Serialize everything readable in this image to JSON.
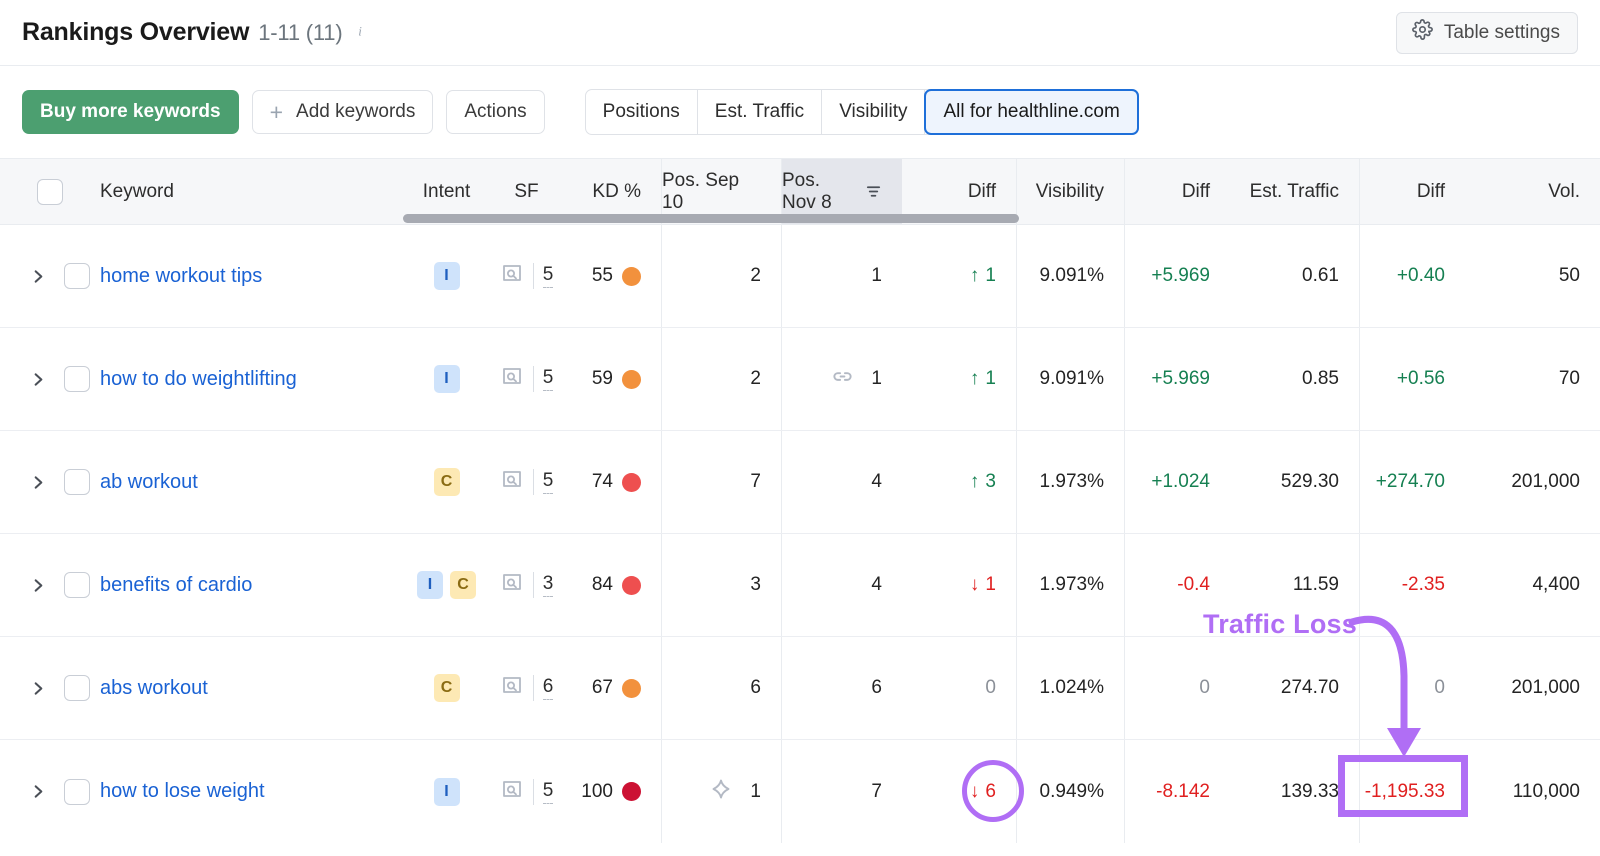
{
  "header": {
    "title": "Rankings Overview",
    "count_range": "1-11 (11)",
    "info_icon": "info-icon",
    "table_settings_label": "Table settings",
    "gear_icon": "gear-icon"
  },
  "toolbar": {
    "buy_label": "Buy more keywords",
    "add_label": "Add keywords",
    "add_plus": "+",
    "actions_label": "Actions",
    "segments": [
      {
        "label": "Positions",
        "active": false
      },
      {
        "label": "Est. Traffic",
        "active": false
      },
      {
        "label": "Visibility",
        "active": false
      },
      {
        "label": "All for healthline.com",
        "active": true
      }
    ]
  },
  "table": {
    "columns": [
      {
        "key": "check",
        "label": ""
      },
      {
        "key": "kw",
        "label": "Keyword"
      },
      {
        "key": "intent",
        "label": "Intent"
      },
      {
        "key": "sf",
        "label": "SF"
      },
      {
        "key": "kd",
        "label": "KD %"
      },
      {
        "key": "pos1",
        "label": "Pos. Sep 10"
      },
      {
        "key": "pos2",
        "label": "Pos. Nov 8",
        "sorted": true,
        "sort_icon": "sort-descending-icon"
      },
      {
        "key": "diff1",
        "label": "Diff"
      },
      {
        "key": "vis",
        "label": "Visibility"
      },
      {
        "key": "diffv",
        "label": "Diff"
      },
      {
        "key": "traf",
        "label": "Est. Traffic"
      },
      {
        "key": "difft",
        "label": "Diff"
      },
      {
        "key": "vol",
        "label": "Vol."
      }
    ],
    "scrollbar": {
      "name": "horizontal-scrollbar"
    },
    "rows": [
      {
        "keyword": "home workout tips",
        "intent": [
          "I"
        ],
        "sf_icon": "serp-feature-icon",
        "sf": "5",
        "kd": "55",
        "kd_color": "#f2913d",
        "pos_sep": "2",
        "pos_sep_icon": "",
        "pos_nov": "1",
        "pos_nov_icon": "",
        "diff_pos": "1",
        "diff_pos_arrow": "↑",
        "diff_pos_dir": "up",
        "visibility": "9.091%",
        "diff_vis": "+5.969",
        "diff_vis_dir": "up",
        "traffic": "0.61",
        "diff_traf": "+0.40",
        "diff_traf_dir": "up",
        "vol": "50"
      },
      {
        "keyword": "how to do weightlifting",
        "intent": [
          "I"
        ],
        "sf_icon": "serp-feature-icon",
        "sf": "5",
        "kd": "59",
        "kd_color": "#f2913d",
        "pos_sep": "2",
        "pos_sep_icon": "",
        "pos_nov": "1",
        "pos_nov_icon": "link-icon",
        "diff_pos": "1",
        "diff_pos_arrow": "↑",
        "diff_pos_dir": "up",
        "visibility": "9.091%",
        "diff_vis": "+5.969",
        "diff_vis_dir": "up",
        "traffic": "0.85",
        "diff_traf": "+0.56",
        "diff_traf_dir": "up",
        "vol": "70"
      },
      {
        "keyword": "ab workout",
        "intent": [
          "C"
        ],
        "sf_icon": "serp-feature-icon",
        "sf": "5",
        "kd": "74",
        "kd_color": "#ee4f4f",
        "pos_sep": "7",
        "pos_sep_icon": "",
        "pos_nov": "4",
        "pos_nov_icon": "",
        "diff_pos": "3",
        "diff_pos_arrow": "↑",
        "diff_pos_dir": "up",
        "visibility": "1.973%",
        "diff_vis": "+1.024",
        "diff_vis_dir": "up",
        "traffic": "529.30",
        "diff_traf": "+274.70",
        "diff_traf_dir": "up",
        "vol": "201,000"
      },
      {
        "keyword": "benefits of cardio",
        "intent": [
          "I",
          "C"
        ],
        "sf_icon": "serp-feature-icon",
        "sf": "3",
        "kd": "84",
        "kd_color": "#ee4f4f",
        "pos_sep": "3",
        "pos_sep_icon": "",
        "pos_nov": "4",
        "pos_nov_icon": "",
        "diff_pos": "1",
        "diff_pos_arrow": "↓",
        "diff_pos_dir": "down",
        "visibility": "1.973%",
        "diff_vis": "-0.4",
        "diff_vis_dir": "down",
        "traffic": "11.59",
        "diff_traf": "-2.35",
        "diff_traf_dir": "down",
        "vol": "4,400"
      },
      {
        "keyword": "abs workout",
        "intent": [
          "C"
        ],
        "sf_icon": "serp-feature-icon",
        "sf": "6",
        "kd": "67",
        "kd_color": "#f2913d",
        "pos_sep": "6",
        "pos_sep_icon": "",
        "pos_nov": "6",
        "pos_nov_icon": "",
        "diff_pos": "0",
        "diff_pos_arrow": "",
        "diff_pos_dir": "zero",
        "visibility": "1.024%",
        "diff_vis": "0",
        "diff_vis_dir": "zero",
        "traffic": "274.70",
        "diff_traf": "0",
        "diff_traf_dir": "zero",
        "vol": "201,000"
      },
      {
        "keyword": "how to lose weight",
        "intent": [
          "I"
        ],
        "sf_icon": "serp-feature-icon",
        "sf": "5",
        "kd": "100",
        "kd_color": "#cc1133",
        "pos_sep": "1",
        "pos_sep_icon": "ai-overview-icon",
        "pos_nov": "7",
        "pos_nov_icon": "",
        "diff_pos": "6",
        "diff_pos_arrow": "↓",
        "diff_pos_dir": "down",
        "visibility": "0.949%",
        "diff_vis": "-8.142",
        "diff_vis_dir": "down",
        "traffic": "139.33",
        "diff_traf": "-1,195.33",
        "diff_traf_dir": "down",
        "vol": "110,000"
      }
    ]
  },
  "annotations": {
    "label": "Traffic Loss",
    "color": "#b06ef5",
    "highlight_circle": "diff-position-highlight",
    "highlight_box": "diff-traffic-highlight"
  }
}
